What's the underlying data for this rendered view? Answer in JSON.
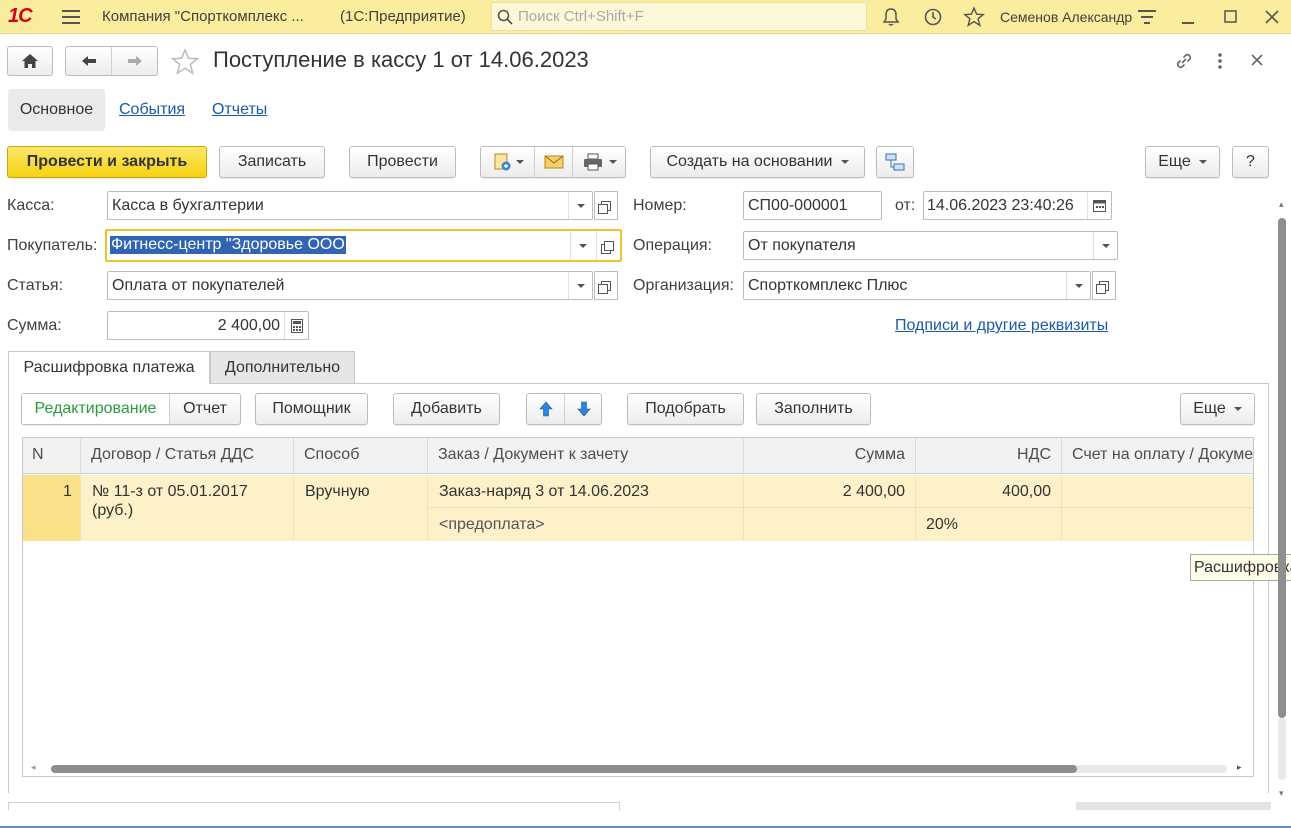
{
  "topbar": {
    "logo": "1С",
    "company": "Компания \"Спорткомплекс ...",
    "app": "(1С:Предприятие)",
    "search_placeholder": "Поиск Ctrl+Shift+F",
    "user": "Семенов Александр"
  },
  "header": {
    "title": "Поступление в кассу 1 от 14.06.2023"
  },
  "tabs": {
    "main": "Основное",
    "events": "События",
    "reports": "Отчеты"
  },
  "toolbar": {
    "post_close": "Провести и закрыть",
    "save": "Записать",
    "post": "Провести",
    "create_based": "Создать на основании",
    "more": "Еще",
    "help": "?"
  },
  "form": {
    "kassa_label": "Касса:",
    "kassa_value": "Касса в бухгалтерии",
    "buyer_label": "Покупатель:",
    "buyer_value": "Фитнесс-центр \"Здоровье ООО",
    "article_label": "Статья:",
    "article_value": "Оплата от покупателей",
    "sum_label": "Сумма:",
    "sum_value": "2 400,00",
    "number_label": "Номер:",
    "number_value": "СП00-000001",
    "date_label": "от:",
    "date_value": "14.06.2023 23:40:26",
    "operation_label": "Операция:",
    "operation_value": "От покупателя",
    "org_label": "Организация:",
    "org_value": "Спорткомплекс Плюс",
    "signatures_link": "Подписи и другие реквизиты"
  },
  "inner_tabs": {
    "decode": "Расшифровка платежа",
    "extra": "Дополнительно"
  },
  "table_toolbar": {
    "edit": "Редактирование",
    "report": "Отчет",
    "assistant": "Помощник",
    "add": "Добавить",
    "pick": "Подобрать",
    "fill": "Заполнить",
    "more": "Еще"
  },
  "table": {
    "columns": [
      "N",
      "Договор / Статья ДДС",
      "Способ",
      "Заказ / Документ к зачету",
      "Сумма",
      "НДС",
      "Счет на оплату / Документ"
    ],
    "rows": [
      {
        "n": "1",
        "contract_line1": "№ 11-з от 05.01.2017",
        "contract_line2": "(руб.)",
        "method": "Вручную",
        "order": "Заказ-наряд 3 от 14.06.2023",
        "order_sub": "<предоплата>",
        "sum": "2 400,00",
        "vat": "400,00",
        "vat_rate": "20%",
        "invoice": ""
      }
    ]
  },
  "tooltip": "Расшифровка платежа",
  "colors": {
    "topbar": "#fbed9e",
    "primary_button": "#f5d211",
    "link": "#1a5aa8",
    "selected_row": "#fcf1c8",
    "focus_border": "#f0c22e",
    "green_text": "#2a9a3b"
  }
}
